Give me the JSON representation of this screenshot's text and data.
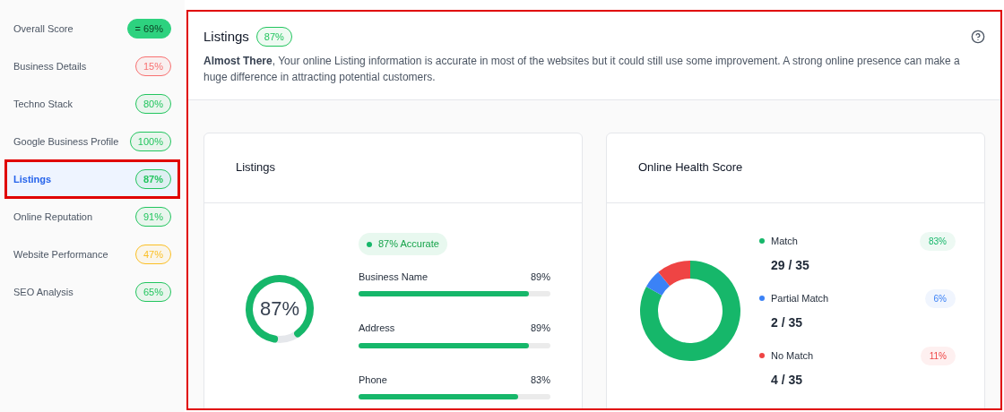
{
  "sidebar": {
    "items": [
      {
        "label": "Overall Score",
        "badge": "= 69%",
        "kind": "solid",
        "color": "#2dd27f",
        "selected": false
      },
      {
        "label": "Business Details",
        "badge": "15%",
        "kind": "outline",
        "color": "#f87171",
        "selected": false
      },
      {
        "label": "Techno Stack",
        "badge": "80%",
        "kind": "outline",
        "color": "#22c55e",
        "selected": false
      },
      {
        "label": "Google Business Profile",
        "badge": "100%",
        "kind": "outline",
        "color": "#22c55e",
        "selected": false
      },
      {
        "label": "Listings",
        "badge": "87%",
        "kind": "outline",
        "color": "#22c55e",
        "selected": true
      },
      {
        "label": "Online Reputation",
        "badge": "91%",
        "kind": "outline",
        "color": "#22c55e",
        "selected": false
      },
      {
        "label": "Website Performance",
        "badge": "47%",
        "kind": "outline",
        "color": "#fbbf24",
        "selected": false
      },
      {
        "label": "SEO Analysis",
        "badge": "65%",
        "kind": "outline",
        "color": "#22c55e",
        "selected": false
      }
    ]
  },
  "panel": {
    "title": "Listings",
    "badge": "87%",
    "lead": "Almost There",
    "description": ", Your online Listing information is accurate in most of the websites but it could still use some improvement. A strong online presence can make a huge difference in attracting potential customers.",
    "listings_card": {
      "title": "Listings",
      "gauge": {
        "reading": "87%"
      },
      "accuracy": "87% Accurate",
      "fields": [
        {
          "name": "Business Name",
          "reading": "89%",
          "level": 0.89
        },
        {
          "name": "Address",
          "reading": "89%",
          "level": 0.89
        },
        {
          "name": "Phone",
          "reading": "83%",
          "level": 0.83
        }
      ]
    },
    "health_card": {
      "title": "Online Health Score",
      "chart_data": {
        "type": "donut",
        "values": [
          83,
          6,
          11
        ]
      },
      "legend": [
        {
          "label": "Match",
          "count": "29 / 35",
          "badge": "83%",
          "color": "#16b76a"
        },
        {
          "label": "Partial Match",
          "count": "2 / 35",
          "badge": "6%",
          "color": "#3b82f6"
        },
        {
          "label": "No Match",
          "count": "4 / 35",
          "badge": "11%",
          "color": "#ef4444"
        }
      ]
    }
  }
}
